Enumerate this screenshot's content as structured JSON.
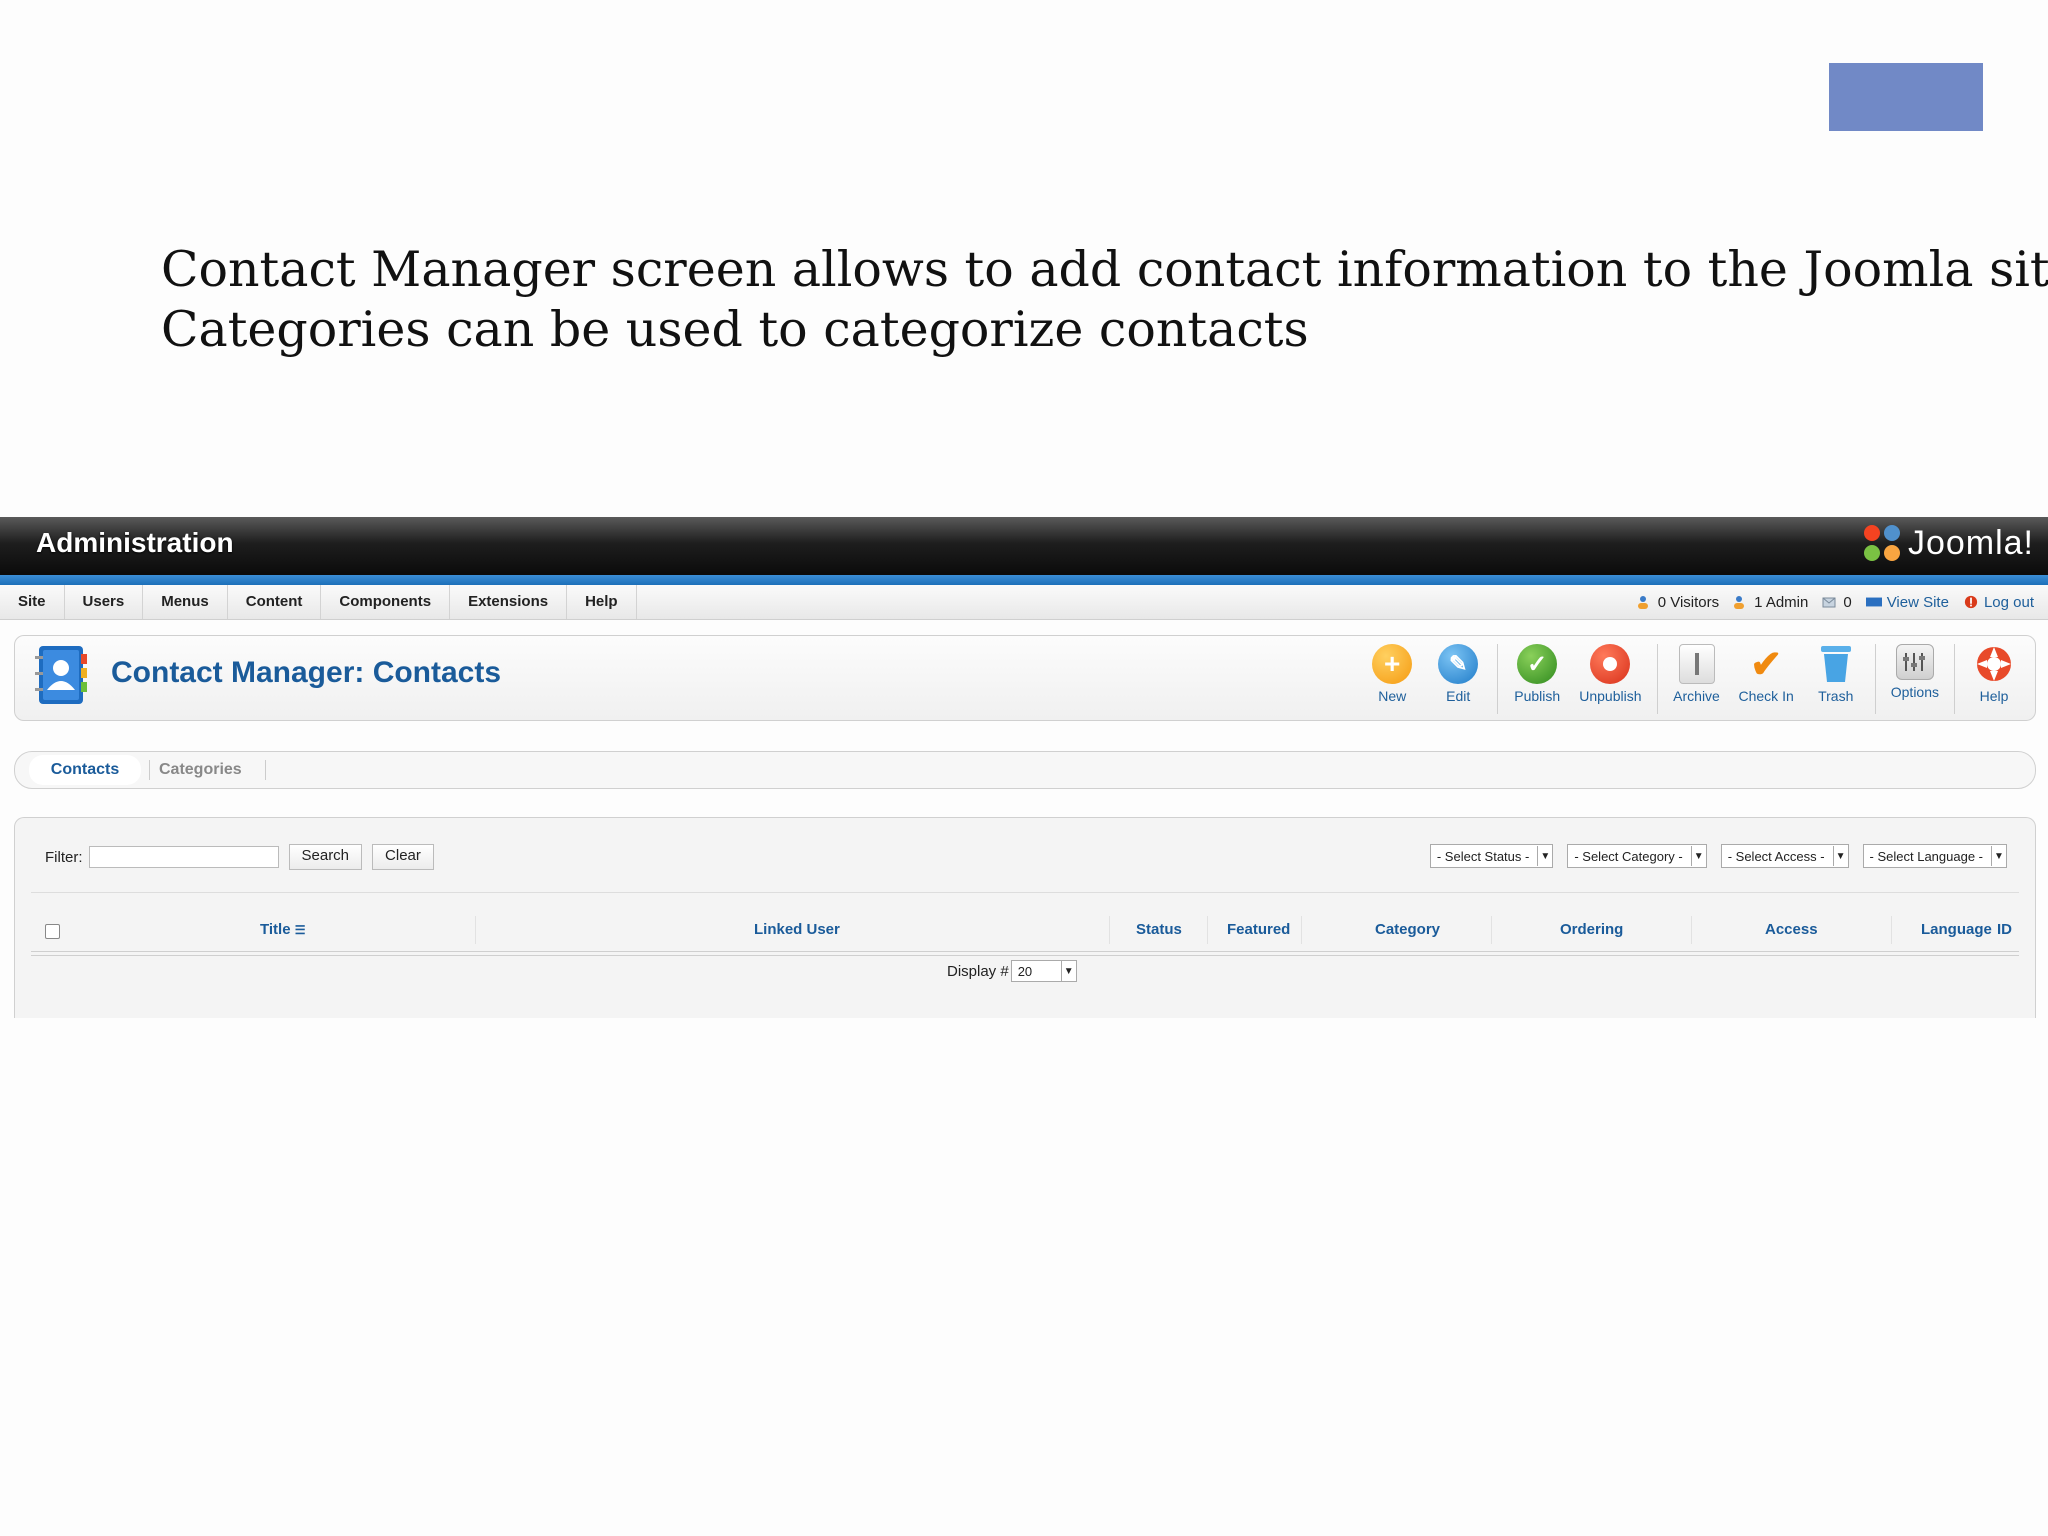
{
  "caption": {
    "line1": "Contact Manager screen allows to add contact information to the Joomla site.",
    "line2": "Categories can be used to categorize contacts"
  },
  "header": {
    "title": "Administration",
    "logo_text": "Joomla!"
  },
  "menu": {
    "items": [
      "Site",
      "Users",
      "Menus",
      "Content",
      "Components",
      "Extensions",
      "Help"
    ]
  },
  "status": {
    "visitors": "0 Visitors",
    "admin": "1 Admin",
    "messages": "0",
    "view_site": "View Site",
    "logout": "Log out"
  },
  "page_title": "Contact Manager: Contacts",
  "toolbar": {
    "new": "New",
    "edit": "Edit",
    "publish": "Publish",
    "unpublish": "Unpublish",
    "archive": "Archive",
    "checkin": "Check In",
    "trash": "Trash",
    "options": "Options",
    "help": "Help"
  },
  "tabs": {
    "contacts": "Contacts",
    "categories": "Categories"
  },
  "filter": {
    "label": "Filter:",
    "value": "",
    "search": "Search",
    "clear": "Clear",
    "status": "- Select Status -",
    "category": "- Select Category -",
    "access": "- Select Access -",
    "language": "- Select Language -"
  },
  "columns": {
    "title": "Title",
    "linked_user": "Linked User",
    "status": "Status",
    "featured": "Featured",
    "category": "Category",
    "ordering": "Ordering",
    "access": "Access",
    "language": "Language",
    "id": "ID"
  },
  "pagination": {
    "label": "Display #",
    "value": "20"
  },
  "colors": {
    "accent_blue": "#1a5b9a",
    "deco_rect": "#7189c6",
    "header_stripe": "#1c6fb8"
  }
}
